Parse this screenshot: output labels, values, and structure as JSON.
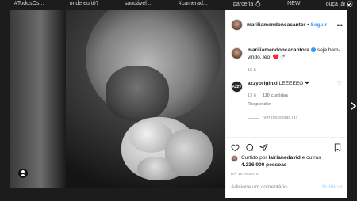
{
  "highlights": [
    "#TodosOs...",
    "onde eu tô?",
    "saudável ...",
    "#camerad...",
    "parceria 💍",
    "NEW",
    "ouça já! 🎧"
  ],
  "post": {
    "author": "mariliamendoncacantor",
    "follow_label": "Seguir",
    "more_label": "•••",
    "caption_author": "mariliamendoncacantora",
    "caption_text": " seja bem-vindo, leo! ♥️🍼",
    "caption_time": "15 h",
    "comment_author": "azzyoriginxl",
    "comment_text": " LEEEEEO ❤",
    "comment_avatar_text": "AZZY",
    "comment_time": "13 h",
    "comment_likes": "110 curtidas",
    "comment_reply": "Responder",
    "view_replies": "Ver respostas (1)",
    "likes_prefix": "Curtido por ",
    "likes_user": "lairianedavid",
    "likes_middle": " e outras ",
    "likes_count": "4.236.900 pessoas",
    "posted_ago": "HÁ 15 HORAS",
    "comment_placeholder": "Adicione um comentário...",
    "publish_label": "Publicar"
  },
  "icons": [
    "heart-icon",
    "comment-icon",
    "share-icon",
    "bookmark-icon",
    "user-tag-icon",
    "next-arrow-icon",
    "close-icon"
  ],
  "colors": {
    "link": "#3897f0",
    "verified": "#3897f0",
    "publish_disabled": "#b2dffc"
  }
}
